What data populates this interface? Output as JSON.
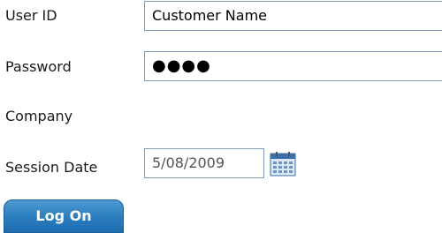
{
  "login_form": {
    "user_id": {
      "label": "User ID",
      "value": "Customer Name"
    },
    "password": {
      "label": "Password",
      "masked_value": "●●●●"
    },
    "company": {
      "label": "Company"
    },
    "session_date": {
      "label": "Session Date",
      "value": "5/08/2009",
      "picker_icon": "calendar-icon"
    },
    "submit": {
      "label": "Log On"
    }
  },
  "colors": {
    "field_border": "#7f9db9",
    "button_blue": "#2a7dbf",
    "label_text": "#1a1a1a",
    "date_text": "#555555"
  }
}
